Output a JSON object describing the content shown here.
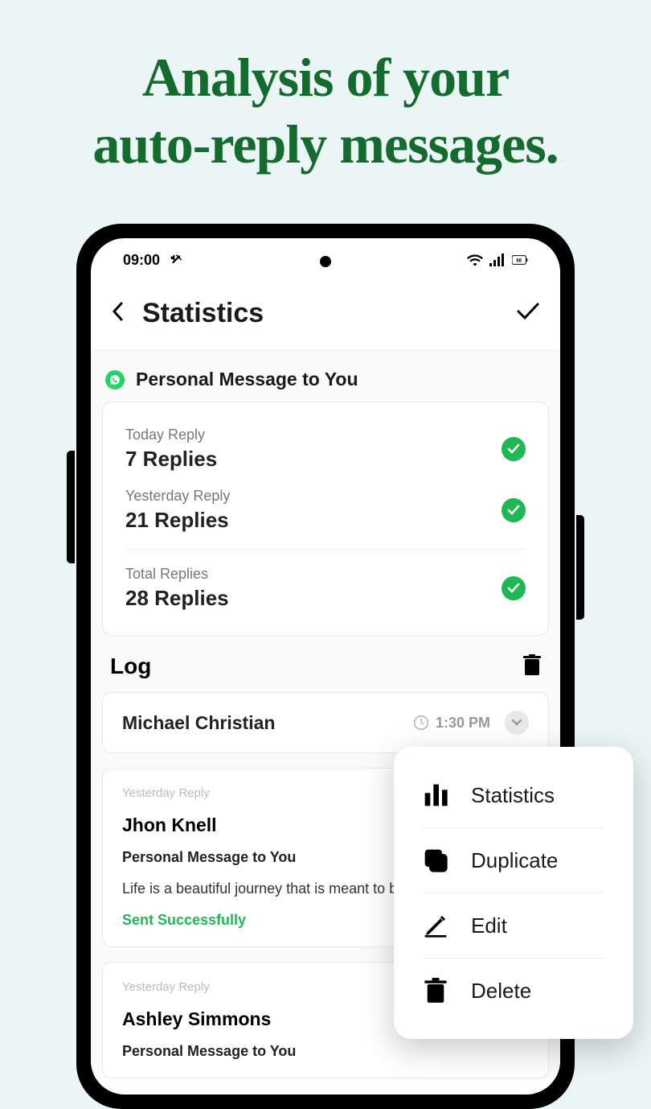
{
  "promo": {
    "headline_l1": "Analysis of your",
    "headline_l2": "auto-reply messages."
  },
  "statusbar": {
    "time": "09:00",
    "battery": "68"
  },
  "header": {
    "title": "Statistics"
  },
  "section": {
    "title": "Personal Message to You"
  },
  "stats": {
    "today_label": "Today Reply",
    "today_value": "7 Replies",
    "yesterday_label": "Yesterday Reply",
    "yesterday_value": "21 Replies",
    "total_label": "Total Replies",
    "total_value": "28 Replies"
  },
  "log": {
    "title": "Log",
    "item1": {
      "name": "Michael Christian",
      "time": "1:30 PM"
    },
    "item2": {
      "badge": "Yesterday Reply",
      "name": "Jhon Knell",
      "subject": "Personal Message to You",
      "body": "Life is a beautiful journey that is meant to be",
      "status": "Sent Successfully"
    },
    "item3": {
      "badge": "Yesterday Reply",
      "name": "Ashley Simmons",
      "subject": "Personal Message to You"
    }
  },
  "popup": {
    "statistics": "Statistics",
    "duplicate": "Duplicate",
    "edit": "Edit",
    "delete": "Delete"
  }
}
